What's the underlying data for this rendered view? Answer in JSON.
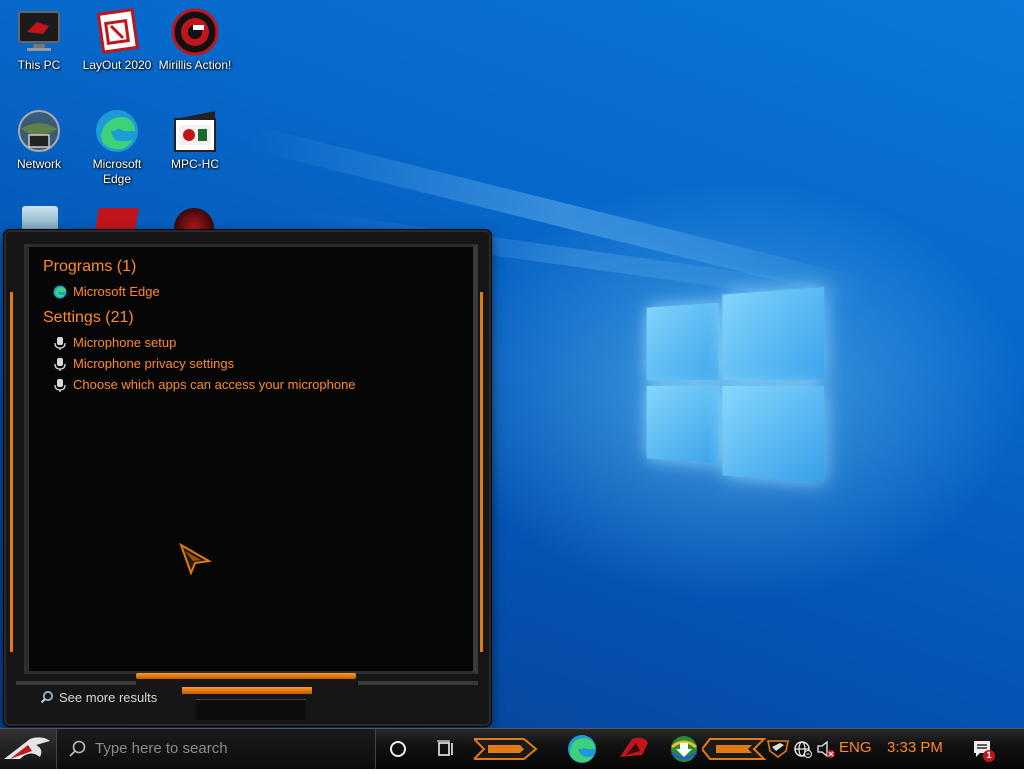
{
  "desktop": {
    "icons": [
      {
        "label": "This PC",
        "icon": "this-pc-icon"
      },
      {
        "label": "LayOut 2020",
        "icon": "layout-2020-icon"
      },
      {
        "label": "Mirillis Action!",
        "icon": "mirillis-action-icon"
      },
      {
        "label": "Network",
        "icon": "network-icon"
      },
      {
        "label": "Microsoft Edge",
        "icon": "edge-icon"
      },
      {
        "label": "MPC-HC",
        "icon": "mpc-hc-icon"
      }
    ]
  },
  "search_panel": {
    "programs_header": "Programs (1)",
    "programs": [
      {
        "label": "Microsoft Edge",
        "icon": "edge-icon"
      }
    ],
    "settings_header": "Settings (21)",
    "settings": [
      {
        "label": "Microphone setup",
        "icon": "microphone-icon"
      },
      {
        "label": "Microphone privacy settings",
        "icon": "microphone-icon"
      },
      {
        "label": "Choose which apps can access your microphone",
        "icon": "microphone-icon"
      }
    ],
    "see_more": "See more results"
  },
  "taskbar": {
    "search_placeholder": "Type here to search",
    "language": "ENG",
    "time": "3:33 PM",
    "notification_count": "1"
  },
  "colors": {
    "accent_orange": "#ff8a2a",
    "desktop_blue": "#0667c9",
    "panel_black": "#060606"
  }
}
